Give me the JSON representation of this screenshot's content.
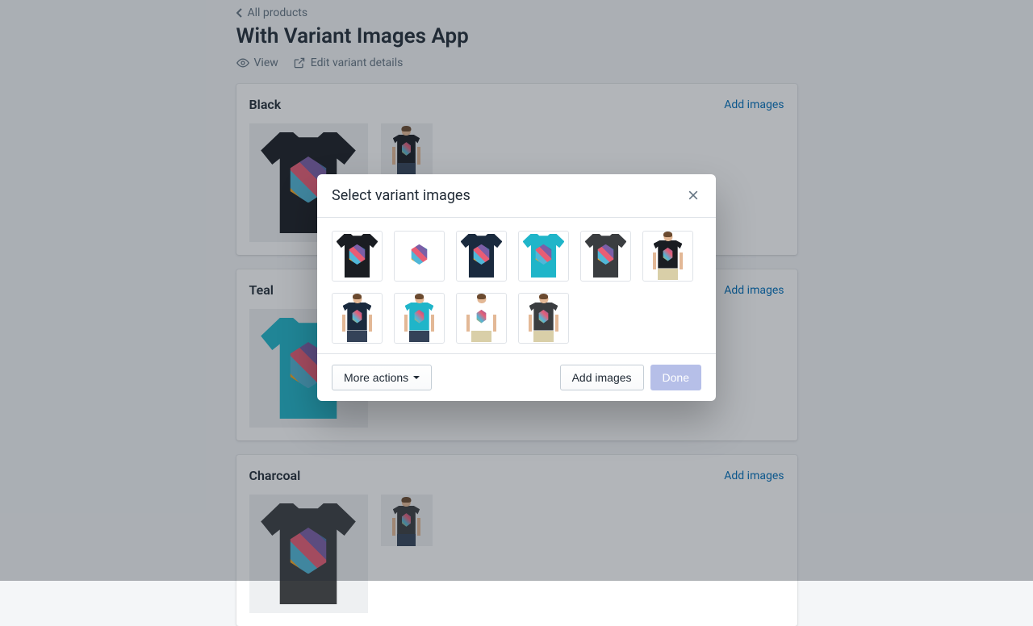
{
  "breadcrumb": {
    "label": "All products"
  },
  "page_title": "With Variant Images App",
  "actions": {
    "view": "View",
    "edit": "Edit variant details"
  },
  "variants": [
    {
      "name": "Black",
      "add_label": "Add images",
      "base_color": "#1a1d22",
      "images": [
        {
          "type": "shirt"
        },
        {
          "type": "model"
        }
      ]
    },
    {
      "name": "Teal",
      "add_label": "Add images",
      "base_color": "#1fb5c9",
      "images": [
        {
          "type": "shirt"
        }
      ]
    },
    {
      "name": "Charcoal",
      "add_label": "Add images",
      "base_color": "#3a3d40",
      "images": [
        {
          "type": "shirt"
        },
        {
          "type": "model"
        }
      ]
    }
  ],
  "modal": {
    "title": "Select variant images",
    "more_actions": "More actions",
    "add_images": "Add images",
    "done": "Done",
    "thumbs": [
      {
        "type": "shirt",
        "color": "#1a1d22"
      },
      {
        "type": "shirt",
        "color": "#ffffff"
      },
      {
        "type": "shirt",
        "color": "#1a2a3e"
      },
      {
        "type": "shirt",
        "color": "#1fb5c9"
      },
      {
        "type": "shirt",
        "color": "#3a3d40"
      },
      {
        "type": "model",
        "color": "#1a1d22",
        "pants": "#d9cfa8"
      },
      {
        "type": "model",
        "color": "#1a2a3e",
        "pants": "#344258"
      },
      {
        "type": "model",
        "color": "#1fb5c9",
        "pants": "#344258"
      },
      {
        "type": "model",
        "color": "#ffffff",
        "pants": "#d9cfa8"
      },
      {
        "type": "model",
        "color": "#3a3d40",
        "pants": "#d9cfa8"
      }
    ]
  }
}
